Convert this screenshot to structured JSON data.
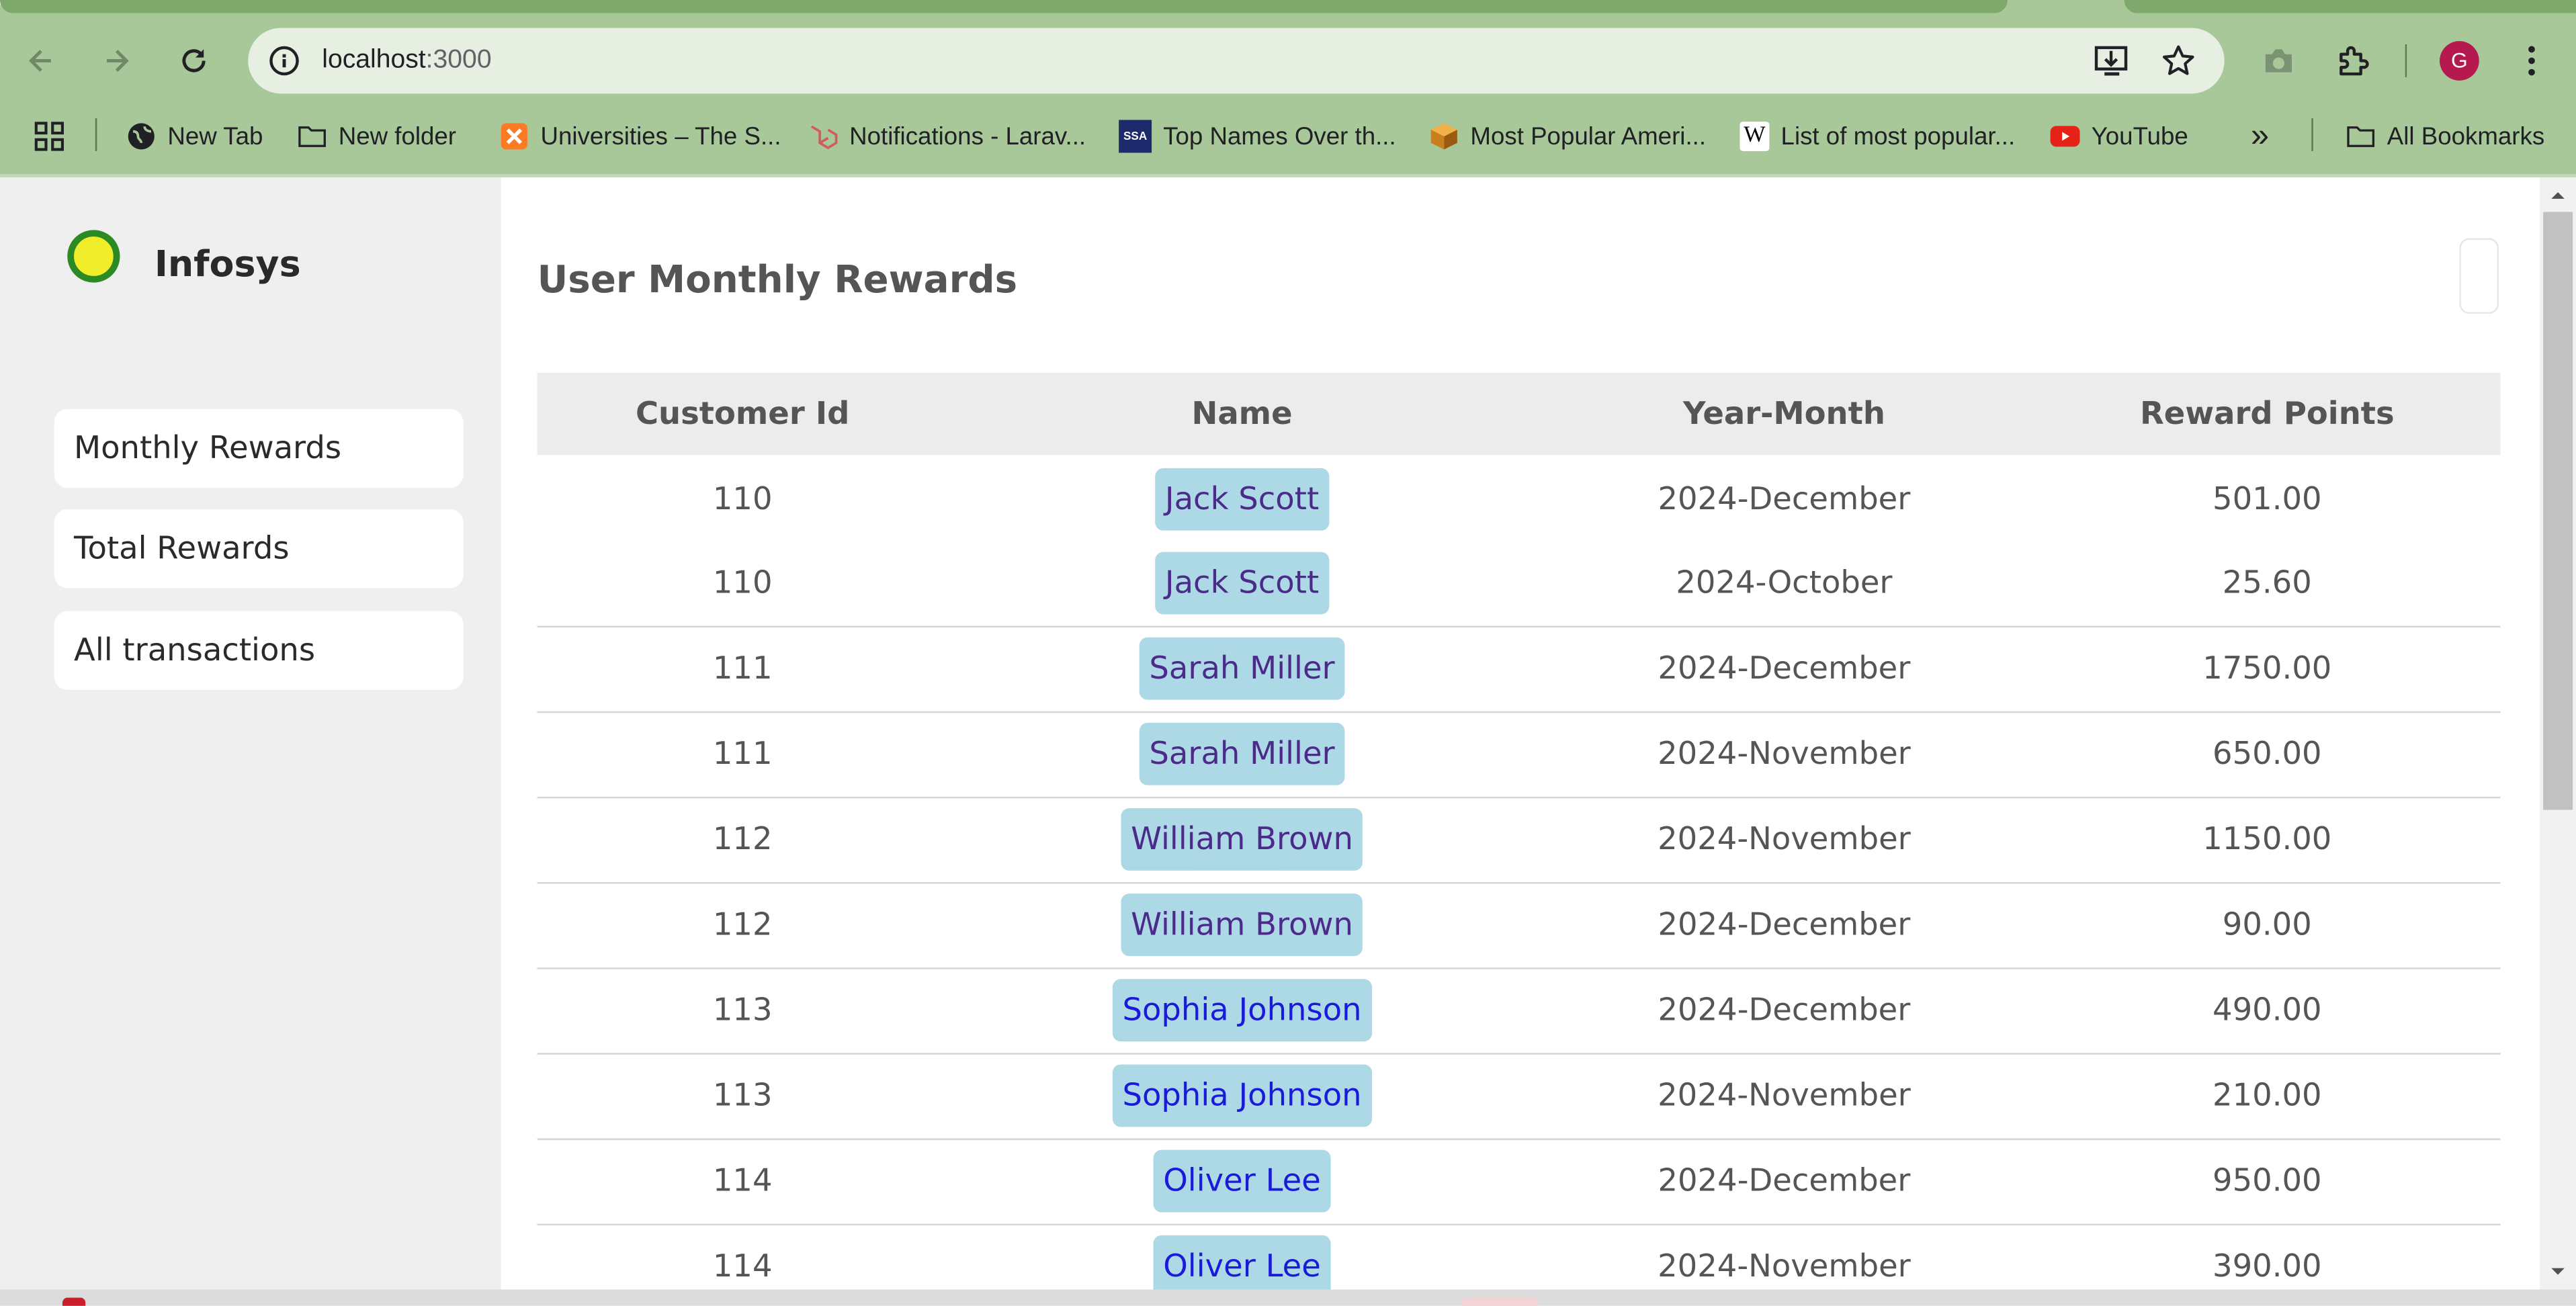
{
  "browser": {
    "url_host": "localhost",
    "url_port": ":3000",
    "profile_initial": "G",
    "bookmarks": [
      {
        "label": "New Tab",
        "icon": "globe-icon"
      },
      {
        "label": "New folder",
        "icon": "folder-icon"
      },
      {
        "label": "Universities – The S...",
        "icon": "xampp-icon"
      },
      {
        "label": "Notifications - Larav...",
        "icon": "laravel-icon"
      },
      {
        "label": "Top Names Over th...",
        "icon": "ssa-icon"
      },
      {
        "label": "Most Popular Ameri...",
        "icon": "cube-icon"
      },
      {
        "label": "List of most popular...",
        "icon": "wikipedia-icon"
      },
      {
        "label": "YouTube",
        "icon": "youtube-icon"
      }
    ],
    "overflow_label": "»",
    "all_bookmarks_label": "All Bookmarks",
    "ssa_text": "SSA",
    "wiki_text": "W"
  },
  "sidebar": {
    "brand": "Infosys",
    "items": [
      {
        "label": "Monthly Rewards"
      },
      {
        "label": "Total Rewards"
      },
      {
        "label": "All transactions"
      }
    ]
  },
  "main": {
    "title": "User Monthly Rewards",
    "columns": [
      "Customer Id",
      "Name",
      "Year-Month",
      "Reward Points"
    ],
    "rows": [
      {
        "id": "110",
        "name": "Jack Scott",
        "month": "2024-December",
        "points": "501.00"
      },
      {
        "id": "110",
        "name": "Jack Scott",
        "month": "2024-October",
        "points": "25.60"
      },
      {
        "id": "111",
        "name": "Sarah Miller",
        "month": "2024-December",
        "points": "1750.00"
      },
      {
        "id": "111",
        "name": "Sarah Miller",
        "month": "2024-November",
        "points": "650.00"
      },
      {
        "id": "112",
        "name": "William Brown",
        "month": "2024-November",
        "points": "1150.00"
      },
      {
        "id": "112",
        "name": "William Brown",
        "month": "2024-December",
        "points": "90.00"
      },
      {
        "id": "113",
        "name": "Sophia Johnson",
        "month": "2024-December",
        "points": "490.00"
      },
      {
        "id": "113",
        "name": "Sophia Johnson",
        "month": "2024-November",
        "points": "210.00"
      },
      {
        "id": "114",
        "name": "Oliver Lee",
        "month": "2024-December",
        "points": "950.00"
      },
      {
        "id": "114",
        "name": "Oliver Lee",
        "month": "2024-November",
        "points": "390.00"
      }
    ]
  },
  "colors": {
    "chrome_bg": "#a8c89a",
    "name_pill": "#add8e6",
    "name_text_visited": "#4b2a8a",
    "name_text_link": "#1a1adb",
    "logo_fill": "#f0ee2a",
    "logo_ring": "#2c8a24"
  }
}
